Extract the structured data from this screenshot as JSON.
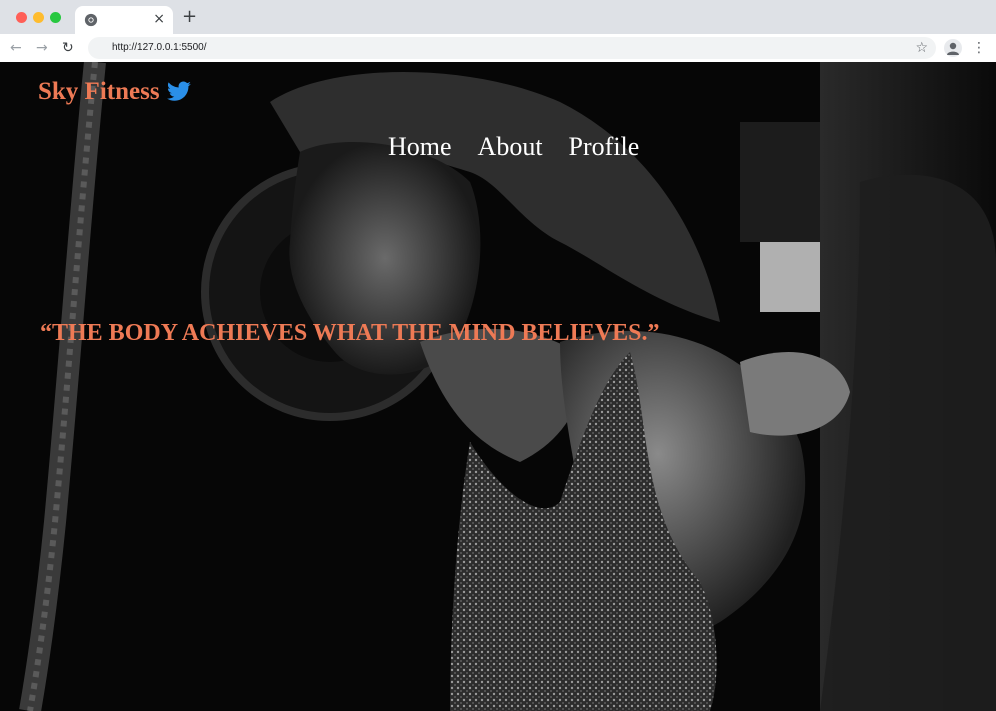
{
  "browser": {
    "url": "http://127.0.0.1:5500/",
    "tab_close": "×",
    "new_tab": "+",
    "back": "←",
    "forward": "→",
    "reload": "↻",
    "star": "☆",
    "menu": "⋮"
  },
  "site": {
    "brand": "Sky Fitness",
    "brand_color": "#ee7a55",
    "logo_icon": "twitter-bird-icon",
    "nav": [
      {
        "label": "Home"
      },
      {
        "label": "About"
      },
      {
        "label": "Profile"
      }
    ],
    "quote": "“THE BODY ACHIEVES WHAT THE MIND BELIEVES.”"
  }
}
